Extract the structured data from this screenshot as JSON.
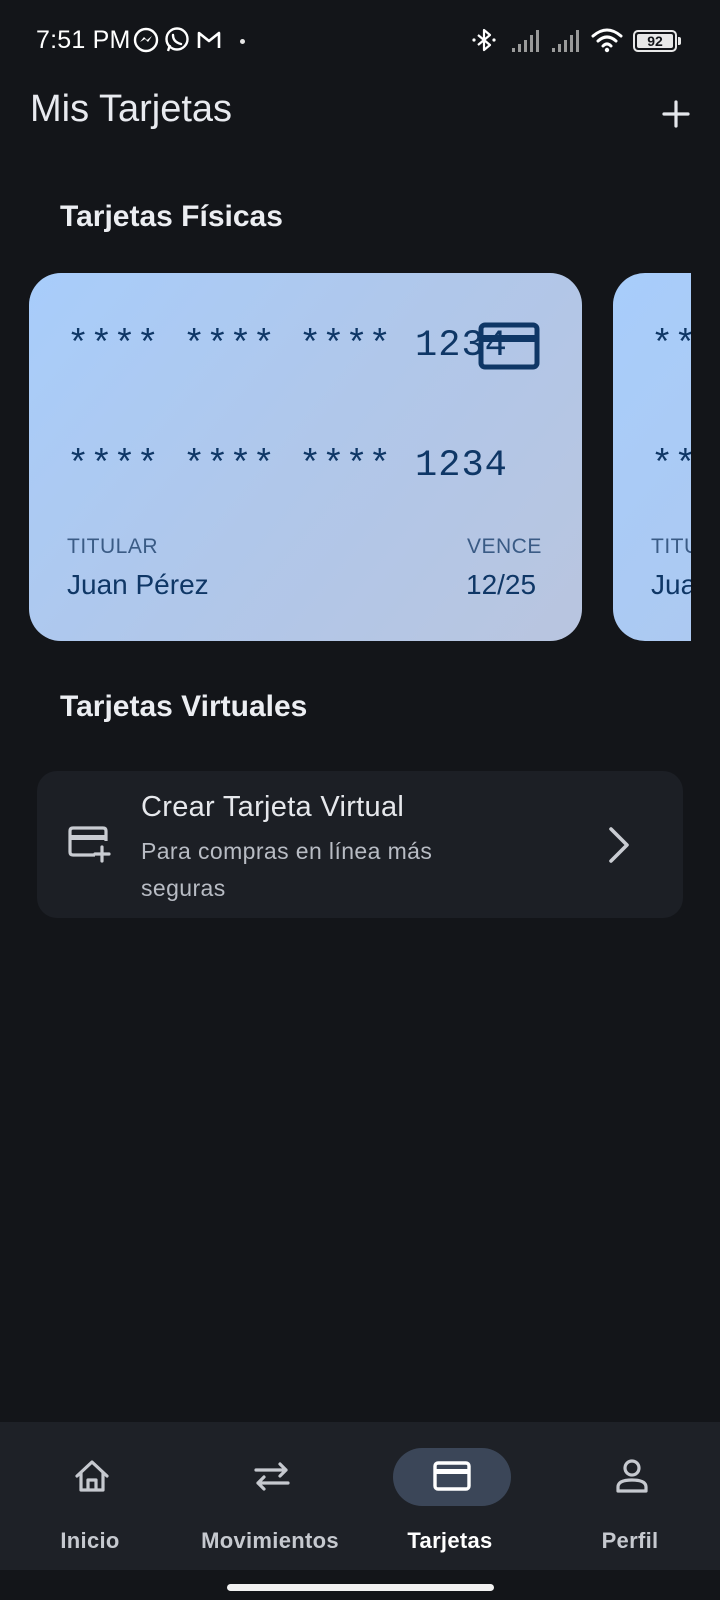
{
  "status_bar": {
    "time": "7:51 PM",
    "notification_icons": [
      "messenger-icon",
      "whatsapp-icon",
      "gmail-icon"
    ],
    "system_icons": [
      "bluetooth-icon",
      "signal-icon",
      "signal-icon",
      "wifi-icon",
      "battery-icon"
    ],
    "battery_level": "92"
  },
  "header": {
    "title": "Mis Tarjetas",
    "add_icon": "plus-icon"
  },
  "physical_section": {
    "title": "Tarjetas Físicas",
    "cards": [
      {
        "number_line_1": "**** **** **** 1234",
        "number_line_2": "**** **** **** 1234",
        "holder_label": "TITULAR",
        "holder_name": "Juan Pérez",
        "expiry_label": "VENCE",
        "expiry": "12/25",
        "icon": "credit-card-icon"
      },
      {
        "number_line_1": "**",
        "number_line_2": "**",
        "holder_label": "TITU",
        "holder_name": "Jua"
      }
    ]
  },
  "virtual_section": {
    "title": "Tarjetas Virtuales",
    "create_item": {
      "icon": "add-card-icon",
      "title": "Crear Tarjeta Virtual",
      "subtitle": "Para compras en línea más seguras",
      "chevron": "chevron-right-icon"
    }
  },
  "bottom_nav": {
    "items": [
      {
        "label": "Inicio",
        "icon": "home-icon",
        "active": false
      },
      {
        "label": "Movimientos",
        "icon": "swap-arrows-icon",
        "active": false
      },
      {
        "label": "Tarjetas",
        "icon": "credit-card-icon",
        "active": true
      },
      {
        "label": "Perfil",
        "icon": "person-icon",
        "active": false
      }
    ]
  },
  "colors": {
    "background": "#131519",
    "surface": "#1c1f25",
    "nav_background": "#1e2127",
    "card_gradient_start": "#a8cdfb",
    "card_gradient_end": "#b9c5df",
    "card_text": "#0f3766",
    "active_pill": "#3b4658"
  }
}
